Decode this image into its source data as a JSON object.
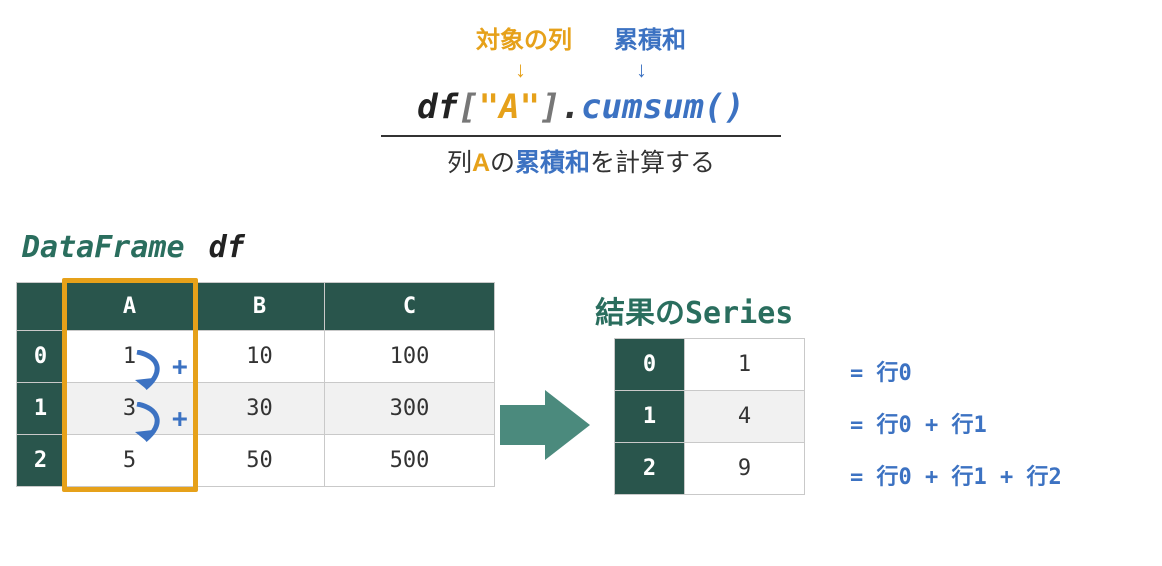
{
  "top": {
    "label_column": "対象の列",
    "label_cumsum": "累積和",
    "arrow_left": "↓",
    "arrow_right": "↓"
  },
  "code": {
    "df": "df",
    "open": "[",
    "quote_open": "\"",
    "col": "A",
    "quote_close": "\"",
    "close": "]",
    "dot": ".",
    "fn": "cumsum",
    "paren": "()"
  },
  "caption": {
    "part1": "列",
    "col": "A",
    "part2": "の",
    "cumtext": "累積和",
    "part3": "を計算する"
  },
  "df_title": {
    "cls": "DataFrame",
    "var": "df"
  },
  "dataframe": {
    "columns": [
      "A",
      "B",
      "C"
    ],
    "index": [
      "0",
      "1",
      "2"
    ],
    "rows": [
      {
        "A": "1",
        "B": "10",
        "C": "100"
      },
      {
        "A": "3",
        "B": "30",
        "C": "300"
      },
      {
        "A": "5",
        "B": "50",
        "C": "500"
      }
    ]
  },
  "plus_symbol": "+",
  "result_title": "結果のSeries",
  "result": {
    "index": [
      "0",
      "1",
      "2"
    ],
    "values": [
      "1",
      "4",
      "9"
    ]
  },
  "formulas": {
    "row0": "= 行0",
    "row1": "= 行0 + 行1",
    "row2": "= 行0 + 行1 + 行2"
  },
  "chart_data": {
    "type": "table",
    "title": "df[\"A\"].cumsum()",
    "source_dataframe": {
      "columns": [
        "A",
        "B",
        "C"
      ],
      "index": [
        0,
        1,
        2
      ],
      "data": [
        [
          1,
          10,
          100
        ],
        [
          3,
          30,
          300
        ],
        [
          5,
          50,
          500
        ]
      ]
    },
    "operation": "cumsum on column A",
    "result_series": {
      "index": [
        0,
        1,
        2
      ],
      "values": [
        1,
        4,
        9
      ]
    },
    "result_derivation": [
      "行0",
      "行0 + 行1",
      "行0 + 行1 + 行2"
    ]
  }
}
